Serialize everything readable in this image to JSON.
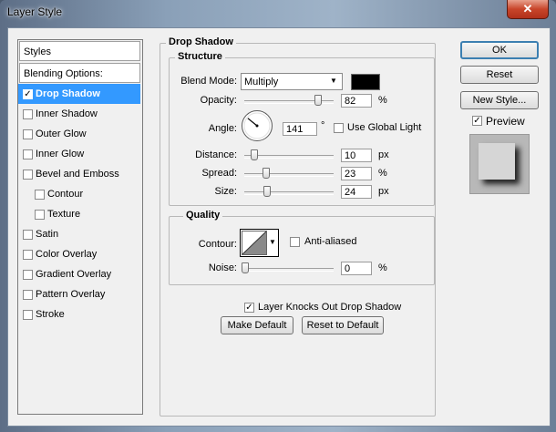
{
  "window": {
    "title": "Layer Style",
    "close_glyph": "✕"
  },
  "styles_panel": {
    "header": "Styles",
    "blending_options": "Blending Options: Custom",
    "items": [
      {
        "label": "Drop Shadow",
        "checked": true,
        "selected": true,
        "indent": false
      },
      {
        "label": "Inner Shadow",
        "checked": false,
        "selected": false,
        "indent": false
      },
      {
        "label": "Outer Glow",
        "checked": false,
        "selected": false,
        "indent": false
      },
      {
        "label": "Inner Glow",
        "checked": false,
        "selected": false,
        "indent": false
      },
      {
        "label": "Bevel and Emboss",
        "checked": false,
        "selected": false,
        "indent": false
      },
      {
        "label": "Contour",
        "checked": false,
        "selected": false,
        "indent": true
      },
      {
        "label": "Texture",
        "checked": false,
        "selected": false,
        "indent": true
      },
      {
        "label": "Satin",
        "checked": false,
        "selected": false,
        "indent": false
      },
      {
        "label": "Color Overlay",
        "checked": false,
        "selected": false,
        "indent": false
      },
      {
        "label": "Gradient Overlay",
        "checked": false,
        "selected": false,
        "indent": false
      },
      {
        "label": "Pattern Overlay",
        "checked": false,
        "selected": false,
        "indent": false
      },
      {
        "label": "Stroke",
        "checked": false,
        "selected": false,
        "indent": false
      }
    ]
  },
  "drop_shadow": {
    "title": "Drop Shadow",
    "structure": {
      "title": "Structure",
      "blend_mode_label": "Blend Mode:",
      "blend_mode_value": "Multiply",
      "shadow_color": "#000000",
      "opacity_label": "Opacity:",
      "opacity_value": "82",
      "opacity_unit": "%",
      "angle_label": "Angle:",
      "angle_value": "141",
      "angle_unit": "°",
      "use_global_light_label": "Use Global Light",
      "use_global_light": false,
      "distance_label": "Distance:",
      "distance_value": "10",
      "distance_unit": "px",
      "spread_label": "Spread:",
      "spread_value": "23",
      "spread_unit": "%",
      "size_label": "Size:",
      "size_value": "24",
      "size_unit": "px"
    },
    "quality": {
      "title": "Quality",
      "contour_label": "Contour:",
      "anti_aliased_label": "Anti-aliased",
      "anti_aliased": false,
      "noise_label": "Noise:",
      "noise_value": "0",
      "noise_unit": "%"
    },
    "knocks_out_label": "Layer Knocks Out Drop Shadow",
    "knocks_out": true,
    "make_default_label": "Make Default",
    "reset_default_label": "Reset to Default"
  },
  "actions": {
    "ok_label": "OK",
    "reset_label": "Reset",
    "new_style_label": "New Style...",
    "preview_label": "Preview",
    "preview_checked": true
  },
  "check_glyph": "✓",
  "dropdown_glyph": "▼"
}
